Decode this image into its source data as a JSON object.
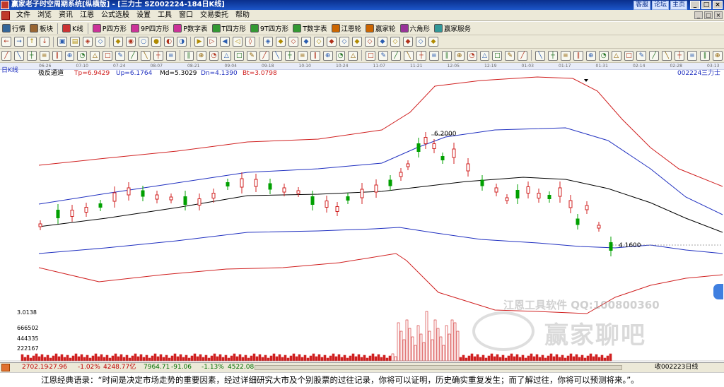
{
  "window": {
    "title": "赢家老子时空周期系统[纵横版] - [三力士  SZ002224-184日K线]",
    "links": [
      "客服",
      "论坛",
      "主页"
    ],
    "controls": [
      "_",
      "□",
      "×"
    ]
  },
  "menu": {
    "items": [
      "文件",
      "浏览",
      "资讯",
      "江恩",
      "公式选股",
      "设置",
      "工具",
      "窗口",
      "交易委托",
      "帮助"
    ],
    "mdi_controls": [
      "_",
      "□",
      "×"
    ]
  },
  "toolbar1": {
    "items": [
      {
        "label": "行情",
        "icon": "market-icon"
      },
      {
        "label": "板块",
        "icon": "sector-icon"
      },
      {
        "label": "K线",
        "icon": "kline-icon"
      },
      {
        "label": "P四方形",
        "icon": "p-square-icon"
      },
      {
        "label": "9P四方形",
        "icon": "9p-square-icon"
      },
      {
        "label": "P数字表",
        "icon": "p-number-table-icon"
      },
      {
        "label": "T四方形",
        "icon": "t-square-icon"
      },
      {
        "label": "9T四方形",
        "icon": "9t-square-icon"
      },
      {
        "label": "T数字表",
        "icon": "t-number-table-icon"
      },
      {
        "label": "江恩轮",
        "icon": "gann-wheel-icon"
      },
      {
        "label": "赢家轮",
        "icon": "winner-wheel-icon"
      },
      {
        "label": "六角形",
        "icon": "hexagon-icon"
      },
      {
        "label": "赢家服务",
        "icon": "service-icon"
      }
    ]
  },
  "indicator": {
    "period": "日K线",
    "name": "极反通道",
    "tp": "Tp=6.9429",
    "up": "Up=6.1764",
    "md": "Md=5.3029",
    "dn": "Dn=4.1390",
    "bt": "Bt=3.0798",
    "code": "002224",
    "stock_name": "三力士",
    "high_marker": "6.2000",
    "low_marker": "4.1600"
  },
  "dates": [
    "06-26",
    "07-10",
    "07-24",
    "08-07",
    "08-21",
    "09-04",
    "09-18",
    "10-10",
    "10-24",
    "11-07",
    "11-21",
    "12-05",
    "12-19",
    "01-03",
    "01-17",
    "01-31",
    "02-14",
    "02-28",
    "03-13"
  ],
  "volume_axis": [
    "3.0138",
    "666502",
    "444335",
    "222167"
  ],
  "watermark": {
    "line1": "江恩工具软件  QQ:100800360",
    "line2": "赢家聊吧",
    "logo": "赢家"
  },
  "status": {
    "idx1_value": "2702.19",
    "idx1_change": "-27.96",
    "idx1_pct": "-1.02%",
    "idx1_vol": "4248.77亿",
    "idx2_value": "7964.71",
    "idx2_change": "-91.06",
    "idx2_pct": "-1.13%",
    "idx2_vol": "4522.08",
    "right_text": "收002223日线"
  },
  "quote": "江恩经典语录：“时间是决定市场走势的重要因素，经过详细研究大市及个别股票的过往记录，你将可以证明，历史确实重复发生；而了解过往，你将可以预测将来。”。",
  "colors": {
    "tp": "#d02020",
    "up": "#2030c0",
    "md": "#000000",
    "up_candle": "#d02020",
    "down_candle": "#00a000"
  }
}
